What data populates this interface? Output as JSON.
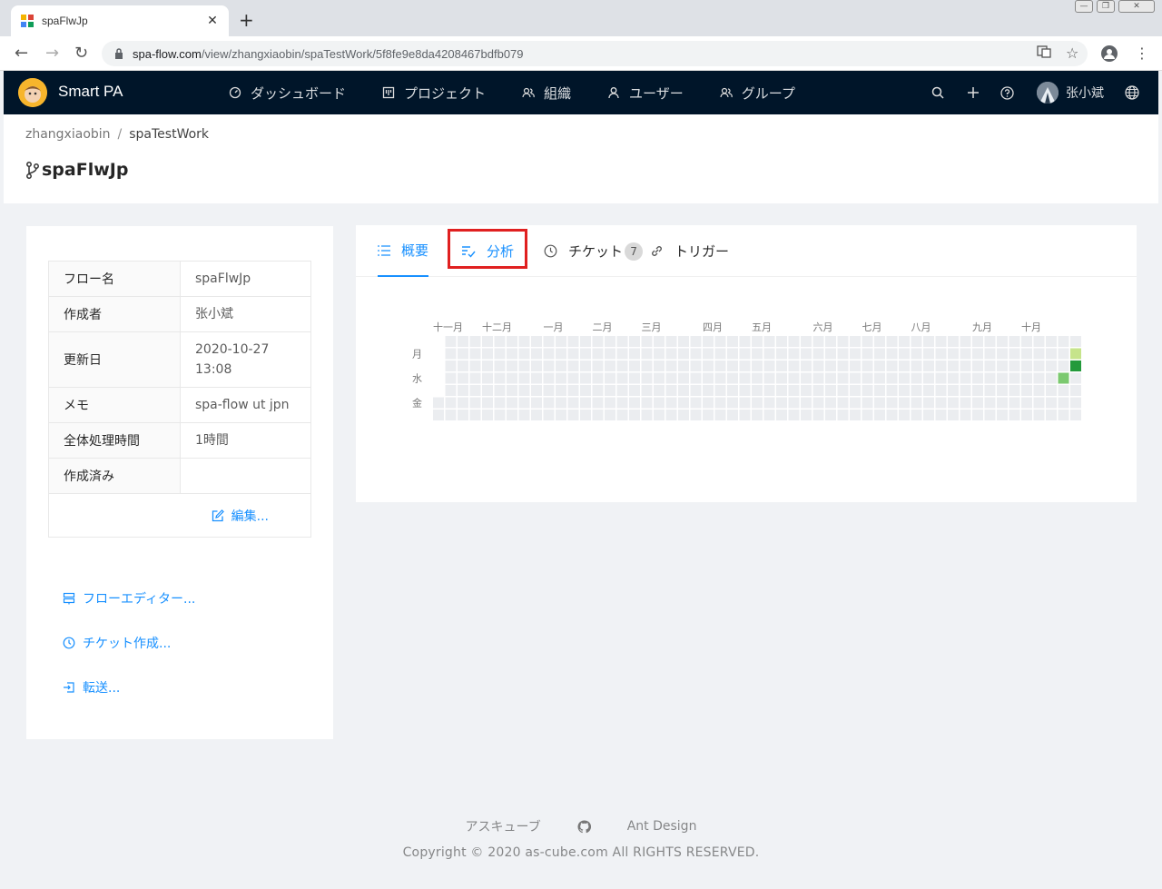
{
  "browser": {
    "tab_title": "spaFlwJp",
    "url_host": "spa-flow.com",
    "url_path": "/view/zhangxiaobin/spaTestWork/5f8fe9e8da4208467bdfb079"
  },
  "header": {
    "app_name": "Smart PA",
    "menu": [
      {
        "label": "ダッシュボード",
        "icon": "dashboard-icon"
      },
      {
        "label": "プロジェクト",
        "icon": "project-icon"
      },
      {
        "label": "組織",
        "icon": "team-icon"
      },
      {
        "label": "ユーザー",
        "icon": "user-icon"
      },
      {
        "label": "グループ",
        "icon": "group-icon"
      }
    ],
    "user_name": "张小斌",
    "colors": {
      "bg": "#001529",
      "accent": "#1890ff"
    }
  },
  "breadcrumb": {
    "items": [
      "zhangxiaobin",
      "spaTestWork"
    ],
    "separator": "/"
  },
  "page": {
    "title": "spaFlwJp"
  },
  "details": {
    "rows": [
      {
        "label": "フロー名",
        "value": "spaFlwJp"
      },
      {
        "label": "作成者",
        "value": "张小斌"
      },
      {
        "label": "更新日",
        "value": "2020-10-27 13:08"
      },
      {
        "label": "メモ",
        "value": "spa-flow ut jpn"
      },
      {
        "label": "全体処理時間",
        "value": "1時間"
      },
      {
        "label": "作成済み",
        "value": ""
      }
    ],
    "edit_label": "編集..."
  },
  "actions": [
    {
      "label": "フローエディター...",
      "icon": "flow-editor-icon"
    },
    {
      "label": "チケット作成...",
      "icon": "ticket-icon"
    },
    {
      "label": "転送...",
      "icon": "transfer-icon"
    }
  ],
  "tabs": [
    {
      "label": "概要",
      "icon": "list-icon",
      "state": "active"
    },
    {
      "label": "分析",
      "icon": "analysis-icon",
      "state": "highlighted"
    },
    {
      "label": "チケット",
      "icon": "ticket-icon",
      "badge": "7"
    },
    {
      "label": "トリガー",
      "icon": "link-icon"
    }
  ],
  "heatmap": {
    "months": [
      "十一月",
      "十二月",
      "一月",
      "二月",
      "三月",
      "四月",
      "五月",
      "六月",
      "七月",
      "八月",
      "九月",
      "十月"
    ],
    "weekdays": [
      "月",
      "水",
      "金"
    ],
    "weeks": 53,
    "active_cells": [
      {
        "week": 52,
        "day": 1,
        "level": 1
      },
      {
        "week": 52,
        "day": 2,
        "level": 3
      },
      {
        "week": 51,
        "day": 3,
        "level": 2
      }
    ],
    "colors": [
      "#ebedf0",
      "#c6e48b",
      "#7bc96f",
      "#239a3b"
    ]
  },
  "footer": {
    "links": [
      "アスキューブ",
      "github-icon",
      "Ant Design"
    ],
    "copyright": "Copyright © 2020 as-cube.com All RIGHTS RESERVED."
  }
}
